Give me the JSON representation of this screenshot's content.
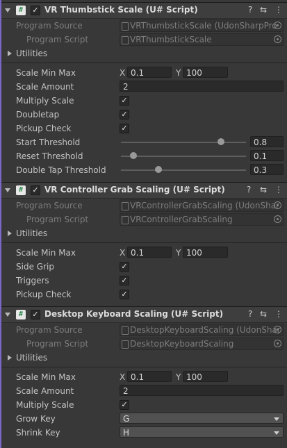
{
  "components": [
    {
      "title": "VR Thumbstick Scale (U# Script)",
      "program_source_label": "Program Source",
      "program_source_value": "VRThumbstickScale (UdonSharpPro",
      "program_script_label": "Program Script",
      "program_script_value": "VRThumbstickScale",
      "utilities_label": "Utilities",
      "scale_min_max_label": "Scale Min Max",
      "x_label": "X",
      "x_value": "0.1",
      "y_label": "Y",
      "y_value": "100",
      "scale_amount_label": "Scale Amount",
      "scale_amount_value": "2",
      "multiply_scale_label": "Multiply Scale",
      "doubletap_label": "Doubletap",
      "pickup_check_label": "Pickup Check",
      "start_threshold_label": "Start Threshold",
      "start_threshold_value": "0.8",
      "reset_threshold_label": "Reset Threshold",
      "reset_threshold_value": "0.1",
      "double_tap_threshold_label": "Double Tap Threshold",
      "double_tap_threshold_value": "0.3"
    },
    {
      "title": "VR Controller Grab Scaling (U# Script)",
      "program_source_label": "Program Source",
      "program_source_value": "VRControllerGrabScaling (UdonShar",
      "program_script_label": "Program Script",
      "program_script_value": "VRControllerGrabScaling",
      "utilities_label": "Utilities",
      "scale_min_max_label": "Scale Min Max",
      "x_label": "X",
      "x_value": "0.1",
      "y_label": "Y",
      "y_value": "100",
      "side_grip_label": "Side Grip",
      "triggers_label": "Triggers",
      "pickup_check_label": "Pickup Check"
    },
    {
      "title": "Desktop Keyboard Scaling (U# Script)",
      "program_source_label": "Program Source",
      "program_source_value": "DesktopKeyboardScaling (UdonShar",
      "program_script_label": "Program Script",
      "program_script_value": "DesktopKeyboardScaling",
      "utilities_label": "Utilities",
      "scale_min_max_label": "Scale Min Max",
      "x_label": "X",
      "x_value": "0.1",
      "y_label": "Y",
      "y_value": "100",
      "scale_amount_label": "Scale Amount",
      "scale_amount_value": "2",
      "multiply_scale_label": "Multiply Scale",
      "grow_key_label": "Grow Key",
      "grow_key_value": "G",
      "shrink_key_label": "Shrink Key",
      "shrink_key_value": "H"
    }
  ],
  "icons": {
    "script_glyph": "#",
    "checkmark": "✓",
    "help": "?",
    "presets": "⇆",
    "more": "⋮"
  },
  "sliders": {
    "start_threshold": 0.8,
    "reset_threshold": 0.1,
    "double_tap_threshold": 0.3
  },
  "colors": {
    "accent": "#7b68c9",
    "background": "#383838",
    "header": "#3e3e3e"
  }
}
